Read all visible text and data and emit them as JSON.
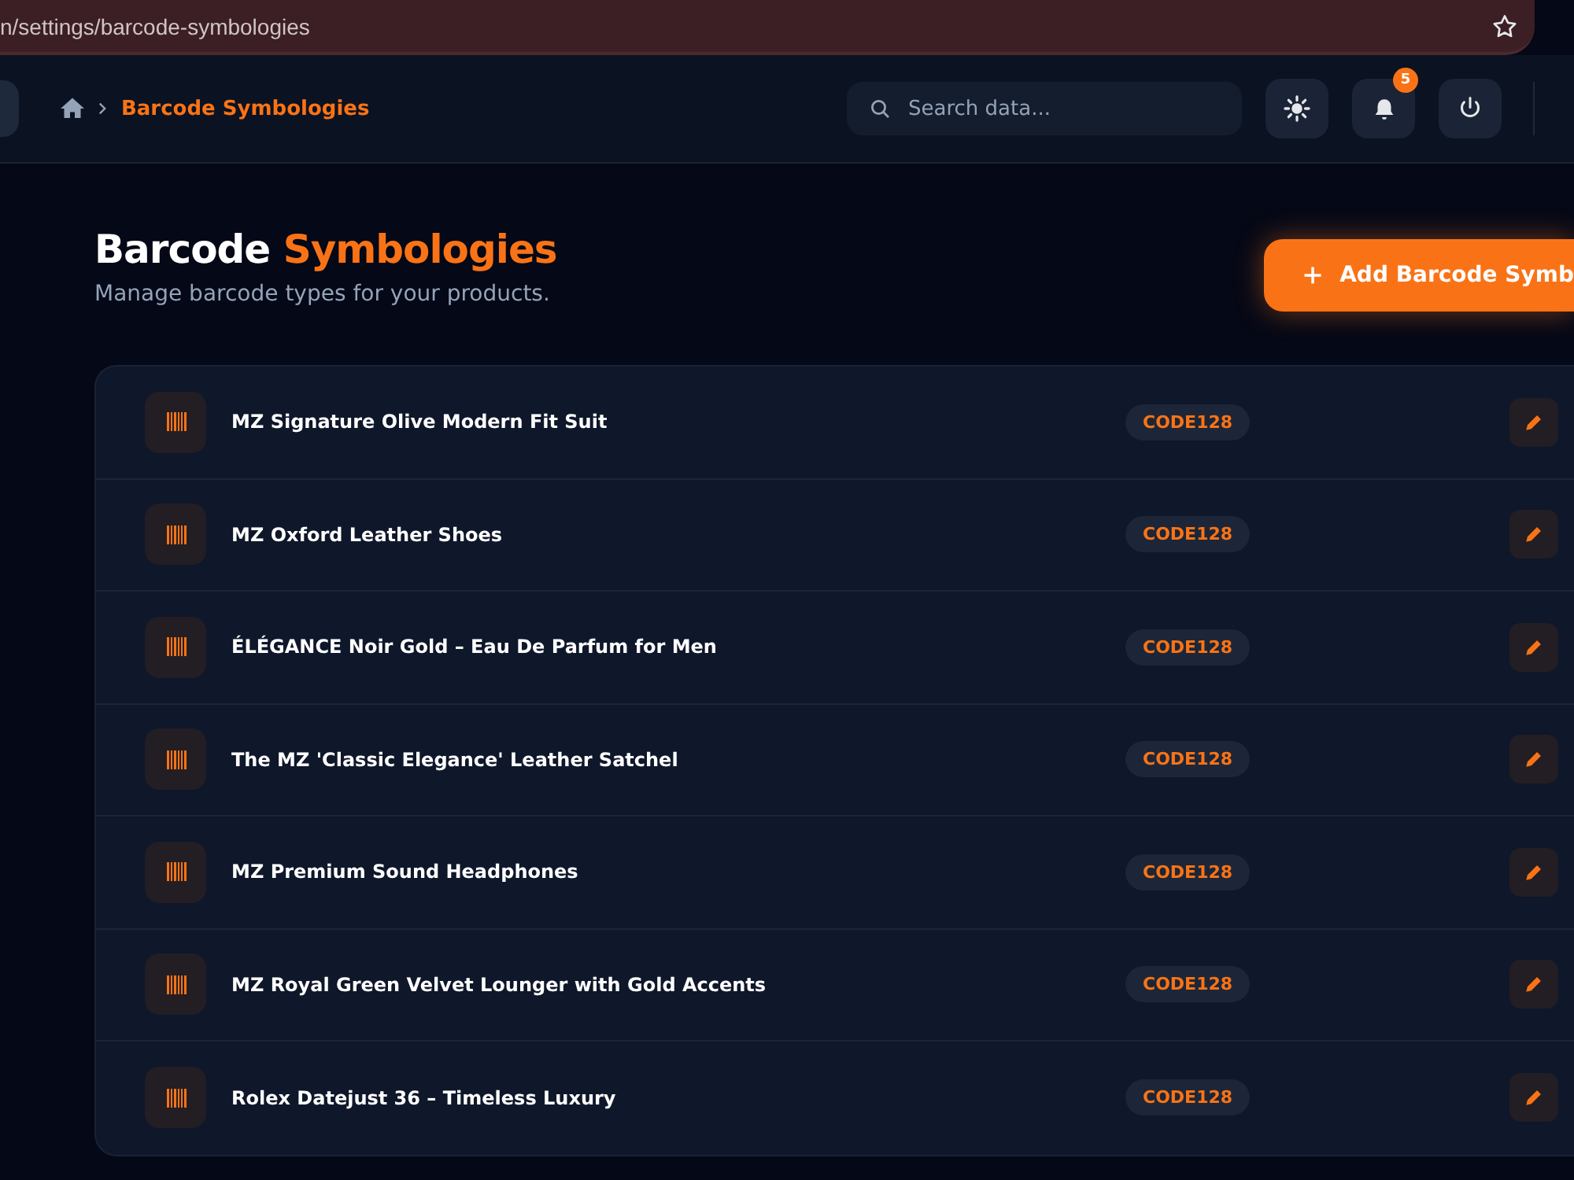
{
  "browser": {
    "url": "n/settings/barcode-symbologies"
  },
  "header": {
    "breadcrumb": "Barcode Symbologies",
    "search": {
      "placeholder": "Search data..."
    },
    "notifications": "5"
  },
  "page": {
    "title": "Barcode",
    "title_accent": "Symbologies",
    "subtitle": "Manage barcode types for your products.",
    "add_button": "Add Barcode Symb"
  },
  "rows": [
    {
      "name": "MZ Signature Olive Modern Fit Suit",
      "type": "CODE128"
    },
    {
      "name": "MZ Oxford Leather Shoes",
      "type": "CODE128"
    },
    {
      "name": "ÉLÉGANCE Noir Gold – Eau De Parfum for Men",
      "type": "CODE128"
    },
    {
      "name": "The MZ 'Classic Elegance' Leather Satchel",
      "type": "CODE128"
    },
    {
      "name": "MZ Premium Sound Headphones",
      "type": "CODE128"
    },
    {
      "name": "MZ Royal Green Velvet Lounger with Gold Accents",
      "type": "CODE128"
    },
    {
      "name": "Rolex Datejust 36 – Timeless Luxury",
      "type": "CODE128"
    }
  ]
}
